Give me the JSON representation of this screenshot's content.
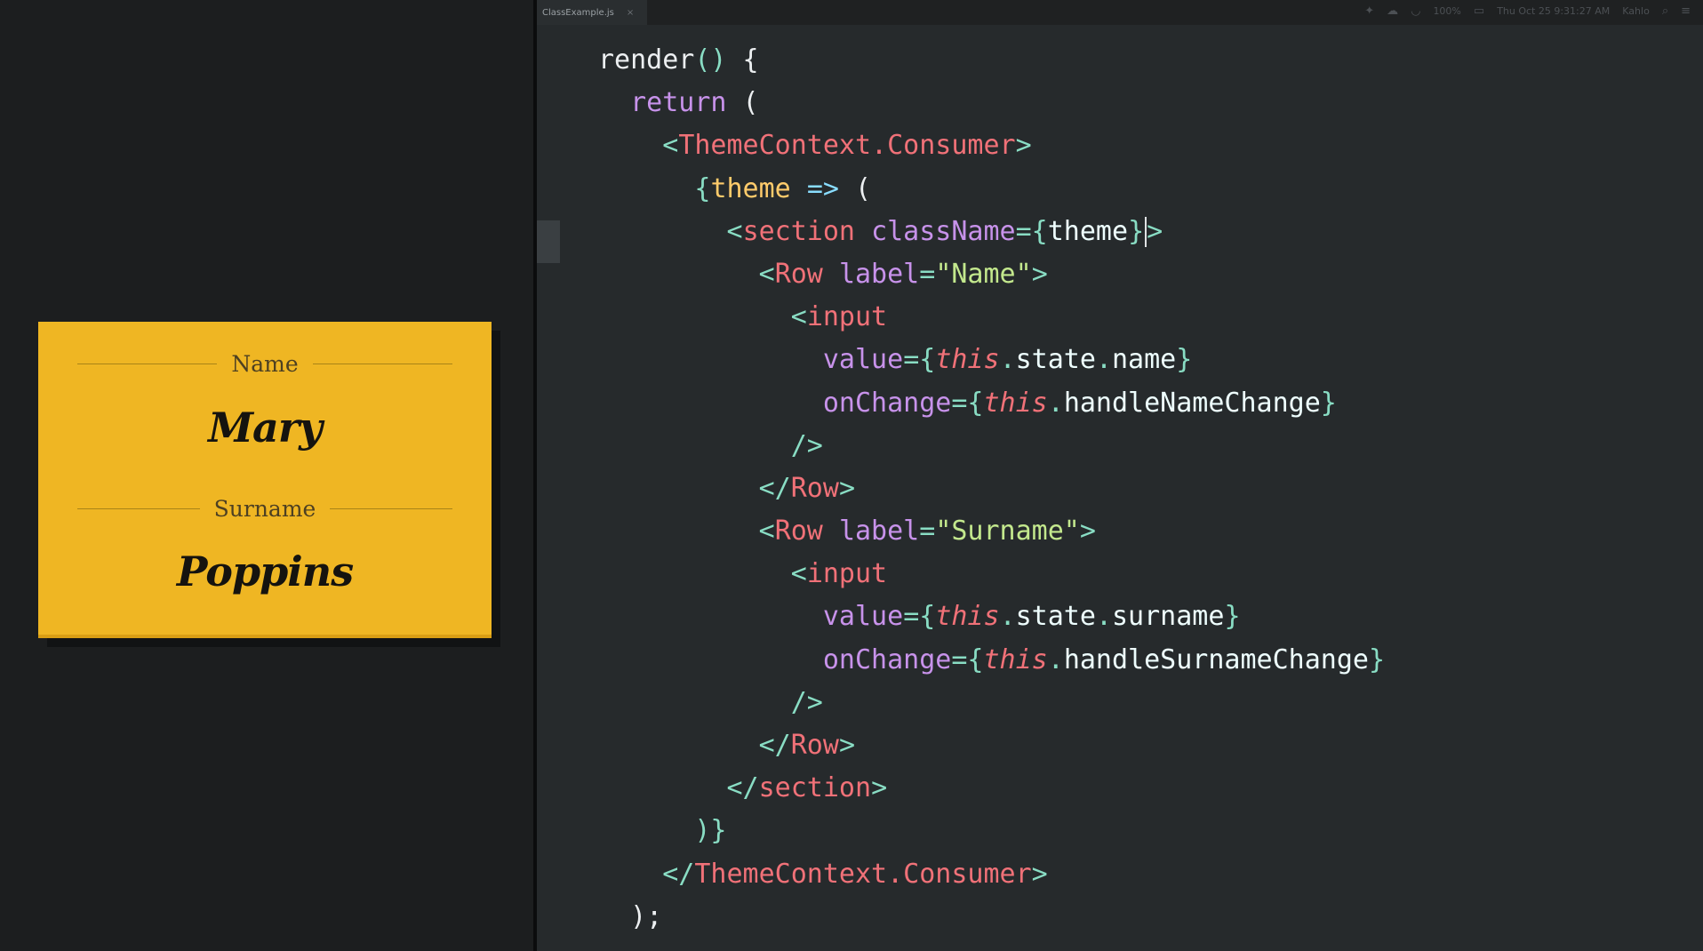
{
  "editor": {
    "tab_title": "ClassExample.js",
    "tab_close": "×",
    "status_date": "Thu Oct 25  9:31:27 AM",
    "status_user": "Kahlo",
    "status_battery": "100%"
  },
  "card": {
    "fields": [
      {
        "label": "Name",
        "value": "Mary"
      },
      {
        "label": "Surname",
        "value": "Poppins"
      }
    ]
  },
  "code": {
    "lines": [
      [
        [
          "c-def",
          "render"
        ],
        [
          "c-punc",
          "()"
        ],
        [
          "c-def",
          " {"
        ]
      ],
      [
        [
          "c-def",
          "  "
        ],
        [
          "c-kw",
          "return"
        ],
        [
          "c-def",
          " ("
        ]
      ],
      [
        [
          "c-def",
          "    "
        ],
        [
          "c-punc",
          "<"
        ],
        [
          "c-tag",
          "ThemeContext.Consumer"
        ],
        [
          "c-punc",
          ">"
        ]
      ],
      [
        [
          "c-def",
          "      "
        ],
        [
          "c-punc",
          "{"
        ],
        [
          "c-var",
          "theme"
        ],
        [
          "c-def",
          " "
        ],
        [
          "c-arrow",
          "=>"
        ],
        [
          "c-def",
          " ("
        ]
      ],
      [
        [
          "c-def",
          "        "
        ],
        [
          "c-punc",
          "<"
        ],
        [
          "c-tag",
          "section"
        ],
        [
          "c-def",
          " "
        ],
        [
          "c-attr",
          "className"
        ],
        [
          "c-punc",
          "={"
        ],
        [
          "c-white",
          "theme"
        ],
        [
          "c-punc",
          "}"
        ],
        [
          "cursor",
          ""
        ],
        [
          "c-punc",
          ">"
        ]
      ],
      [
        [
          "c-def",
          "          "
        ],
        [
          "c-punc",
          "<"
        ],
        [
          "c-tag",
          "Row"
        ],
        [
          "c-def",
          " "
        ],
        [
          "c-attr",
          "label"
        ],
        [
          "c-punc",
          "="
        ],
        [
          "c-str",
          "\"Name\""
        ],
        [
          "c-punc",
          ">"
        ]
      ],
      [
        [
          "c-def",
          "            "
        ],
        [
          "c-punc",
          "<"
        ],
        [
          "c-tag",
          "input"
        ]
      ],
      [
        [
          "c-def",
          "              "
        ],
        [
          "c-attr",
          "value"
        ],
        [
          "c-punc",
          "={"
        ],
        [
          "c-this",
          "this"
        ],
        [
          "c-punc",
          "."
        ],
        [
          "c-white",
          "state"
        ],
        [
          "c-punc",
          "."
        ],
        [
          "c-white",
          "name"
        ],
        [
          "c-punc",
          "}"
        ]
      ],
      [
        [
          "c-def",
          "              "
        ],
        [
          "c-attr",
          "onChange"
        ],
        [
          "c-punc",
          "={"
        ],
        [
          "c-this",
          "this"
        ],
        [
          "c-punc",
          "."
        ],
        [
          "c-white",
          "handleNameChange"
        ],
        [
          "c-punc",
          "}"
        ]
      ],
      [
        [
          "c-def",
          "            "
        ],
        [
          "c-punc",
          "/>"
        ]
      ],
      [
        [
          "c-def",
          "          "
        ],
        [
          "c-punc",
          "</"
        ],
        [
          "c-tag",
          "Row"
        ],
        [
          "c-punc",
          ">"
        ]
      ],
      [
        [
          "c-def",
          "          "
        ],
        [
          "c-punc",
          "<"
        ],
        [
          "c-tag",
          "Row"
        ],
        [
          "c-def",
          " "
        ],
        [
          "c-attr",
          "label"
        ],
        [
          "c-punc",
          "="
        ],
        [
          "c-str",
          "\"Surname\""
        ],
        [
          "c-punc",
          ">"
        ]
      ],
      [
        [
          "c-def",
          "            "
        ],
        [
          "c-punc",
          "<"
        ],
        [
          "c-tag",
          "input"
        ]
      ],
      [
        [
          "c-def",
          "              "
        ],
        [
          "c-attr",
          "value"
        ],
        [
          "c-punc",
          "={"
        ],
        [
          "c-this",
          "this"
        ],
        [
          "c-punc",
          "."
        ],
        [
          "c-white",
          "state"
        ],
        [
          "c-punc",
          "."
        ],
        [
          "c-white",
          "surname"
        ],
        [
          "c-punc",
          "}"
        ]
      ],
      [
        [
          "c-def",
          "              "
        ],
        [
          "c-attr",
          "onChange"
        ],
        [
          "c-punc",
          "={"
        ],
        [
          "c-this",
          "this"
        ],
        [
          "c-punc",
          "."
        ],
        [
          "c-white",
          "handleSurnameChange"
        ],
        [
          "c-punc",
          "}"
        ]
      ],
      [
        [
          "c-def",
          "            "
        ],
        [
          "c-punc",
          "/>"
        ]
      ],
      [
        [
          "c-def",
          "          "
        ],
        [
          "c-punc",
          "</"
        ],
        [
          "c-tag",
          "Row"
        ],
        [
          "c-punc",
          ">"
        ]
      ],
      [
        [
          "c-def",
          "        "
        ],
        [
          "c-punc",
          "</"
        ],
        [
          "c-tag",
          "section"
        ],
        [
          "c-punc",
          ">"
        ]
      ],
      [
        [
          "c-def",
          "      "
        ],
        [
          "c-punc",
          ")}"
        ]
      ],
      [
        [
          "c-def",
          "    "
        ],
        [
          "c-punc",
          "</"
        ],
        [
          "c-tag",
          "ThemeContext.Consumer"
        ],
        [
          "c-punc",
          ">"
        ]
      ],
      [
        [
          "c-def",
          "  );"
        ]
      ]
    ]
  }
}
